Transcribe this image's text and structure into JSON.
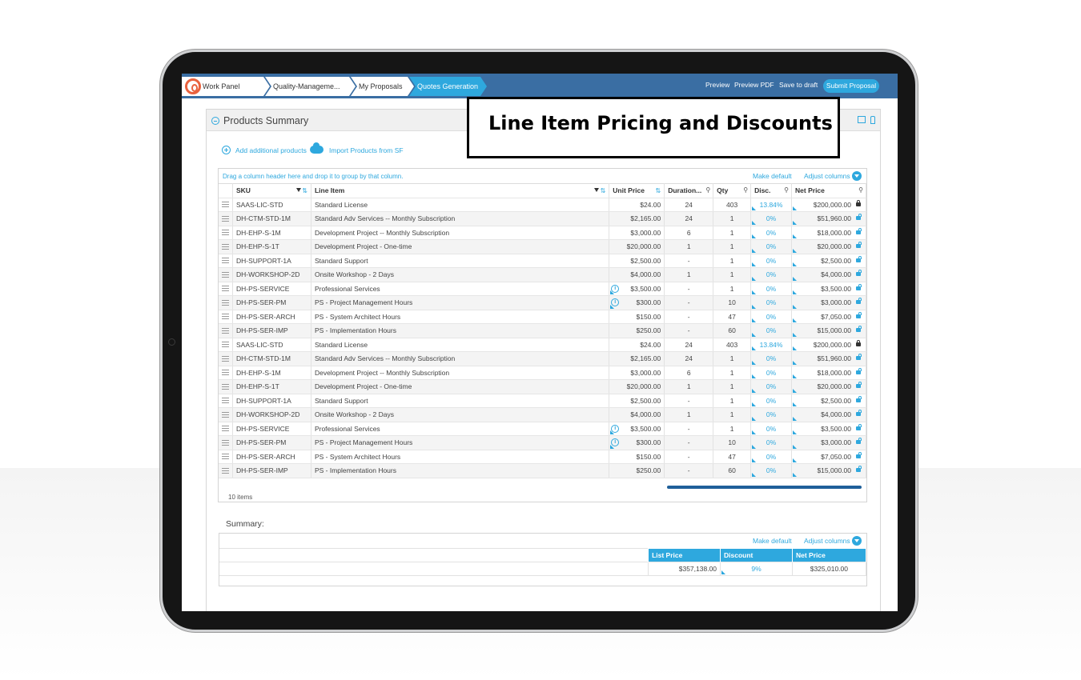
{
  "nav": {
    "breadcrumbs": [
      "Work Panel",
      "Quality-Manageme...",
      "My Proposals",
      "Quotes Generation"
    ],
    "actions": {
      "preview": "Preview",
      "preview_pdf": "Preview PDF",
      "save_draft": "Save to draft",
      "submit": "Submit Proposal"
    }
  },
  "panel": {
    "title": "Products Summary"
  },
  "overlay": {
    "text": "Line Item Pricing and Discounts"
  },
  "toolbar": {
    "add_products": "Add additional products",
    "import_products": "Import Products from SF"
  },
  "grid": {
    "hint": "Drag a column header here and drop it to group by that column.",
    "make_default": "Make default",
    "adjust_columns": "Adjust columns",
    "columns": [
      "SKU",
      "Line Item",
      "Unit Price",
      "Duration...",
      "Qty",
      "Disc.",
      "Net Price"
    ],
    "rows": [
      {
        "sku": "SAAS-LIC-STD",
        "item": "Standard License",
        "price": "$24.00",
        "duration": "24",
        "qty": "403",
        "disc": "13.84%",
        "net": "$200,000.00",
        "locked": true,
        "info": false
      },
      {
        "sku": "DH-CTM-STD-1M",
        "item": "Standard Adv Services -- Monthly Subscription",
        "price": "$2,165.00",
        "duration": "24",
        "qty": "1",
        "disc": "0%",
        "net": "$51,960.00",
        "locked": false,
        "info": false
      },
      {
        "sku": "DH-EHP-S-1M",
        "item": "Development Project -- Monthly Subscription",
        "price": "$3,000.00",
        "duration": "6",
        "qty": "1",
        "disc": "0%",
        "net": "$18,000.00",
        "locked": false,
        "info": false
      },
      {
        "sku": "DH-EHP-S-1T",
        "item": "Development Project - One-time",
        "price": "$20,000.00",
        "duration": "1",
        "qty": "1",
        "disc": "0%",
        "net": "$20,000.00",
        "locked": false,
        "info": false
      },
      {
        "sku": "DH-SUPPORT-1A",
        "item": "Standard Support",
        "price": "$2,500.00",
        "duration": "-",
        "qty": "1",
        "disc": "0%",
        "net": "$2,500.00",
        "locked": false,
        "info": false
      },
      {
        "sku": "DH-WORKSHOP-2D",
        "item": "Onsite Workshop - 2 Days",
        "price": "$4,000.00",
        "duration": "1",
        "qty": "1",
        "disc": "0%",
        "net": "$4,000.00",
        "locked": false,
        "info": false
      },
      {
        "sku": "DH-PS-SERVICE",
        "item": "Professional Services",
        "price": "$3,500.00",
        "duration": "-",
        "qty": "1",
        "disc": "0%",
        "net": "$3,500.00",
        "locked": false,
        "info": true
      },
      {
        "sku": "DH-PS-SER-PM",
        "item": "PS - Project Management Hours",
        "price": "$300.00",
        "duration": "-",
        "qty": "10",
        "disc": "0%",
        "net": "$3,000.00",
        "locked": false,
        "info": true
      },
      {
        "sku": "DH-PS-SER-ARCH",
        "item": "PS - System Architect Hours",
        "price": "$150.00",
        "duration": "-",
        "qty": "47",
        "disc": "0%",
        "net": "$7,050.00",
        "locked": false,
        "info": false
      },
      {
        "sku": "DH-PS-SER-IMP",
        "item": "PS - Implementation Hours",
        "price": "$250.00",
        "duration": "-",
        "qty": "60",
        "disc": "0%",
        "net": "$15,000.00",
        "locked": false,
        "info": false
      },
      {
        "sku": "SAAS-LIC-STD",
        "item": "Standard License",
        "price": "$24.00",
        "duration": "24",
        "qty": "403",
        "disc": "13.84%",
        "net": "$200,000.00",
        "locked": true,
        "info": false
      },
      {
        "sku": "DH-CTM-STD-1M",
        "item": "Standard Adv Services -- Monthly Subscription",
        "price": "$2,165.00",
        "duration": "24",
        "qty": "1",
        "disc": "0%",
        "net": "$51,960.00",
        "locked": false,
        "info": false
      },
      {
        "sku": "DH-EHP-S-1M",
        "item": "Development Project -- Monthly Subscription",
        "price": "$3,000.00",
        "duration": "6",
        "qty": "1",
        "disc": "0%",
        "net": "$18,000.00",
        "locked": false,
        "info": false
      },
      {
        "sku": "DH-EHP-S-1T",
        "item": "Development Project - One-time",
        "price": "$20,000.00",
        "duration": "1",
        "qty": "1",
        "disc": "0%",
        "net": "$20,000.00",
        "locked": false,
        "info": false
      },
      {
        "sku": "DH-SUPPORT-1A",
        "item": "Standard Support",
        "price": "$2,500.00",
        "duration": "-",
        "qty": "1",
        "disc": "0%",
        "net": "$2,500.00",
        "locked": false,
        "info": false
      },
      {
        "sku": "DH-WORKSHOP-2D",
        "item": "Onsite Workshop - 2 Days",
        "price": "$4,000.00",
        "duration": "1",
        "qty": "1",
        "disc": "0%",
        "net": "$4,000.00",
        "locked": false,
        "info": false
      },
      {
        "sku": "DH-PS-SERVICE",
        "item": "Professional Services",
        "price": "$3,500.00",
        "duration": "-",
        "qty": "1",
        "disc": "0%",
        "net": "$3,500.00",
        "locked": false,
        "info": true
      },
      {
        "sku": "DH-PS-SER-PM",
        "item": "PS - Project Management Hours",
        "price": "$300.00",
        "duration": "-",
        "qty": "10",
        "disc": "0%",
        "net": "$3,000.00",
        "locked": false,
        "info": true
      },
      {
        "sku": "DH-PS-SER-ARCH",
        "item": "PS - System Architect Hours",
        "price": "$150.00",
        "duration": "-",
        "qty": "47",
        "disc": "0%",
        "net": "$7,050.00",
        "locked": false,
        "info": false
      },
      {
        "sku": "DH-PS-SER-IMP",
        "item": "PS - Implementation Hours",
        "price": "$250.00",
        "duration": "-",
        "qty": "60",
        "disc": "0%",
        "net": "$15,000.00",
        "locked": false,
        "info": false
      }
    ],
    "item_count": "10 items"
  },
  "summary": {
    "title": "Summary:",
    "make_default": "Make default",
    "adjust_columns": "Adjust columns",
    "columns": [
      "List Price",
      "Discount",
      "Net Price"
    ],
    "values": {
      "list_price": "$357,138.00",
      "discount": "9%",
      "net_price": "$325,010.00"
    }
  },
  "colors": {
    "accent": "#2ea8de",
    "nav": "#3a6ea3",
    "logo": "#e9623e"
  },
  "icons": [
    "logo-icon",
    "collapse-icon",
    "plus-icon",
    "cloud-icon",
    "filter-icon",
    "sort-icon",
    "pin-icon",
    "lock-icon",
    "unlock-icon",
    "info-icon",
    "drag-handle-icon",
    "chevron-down-icon"
  ]
}
